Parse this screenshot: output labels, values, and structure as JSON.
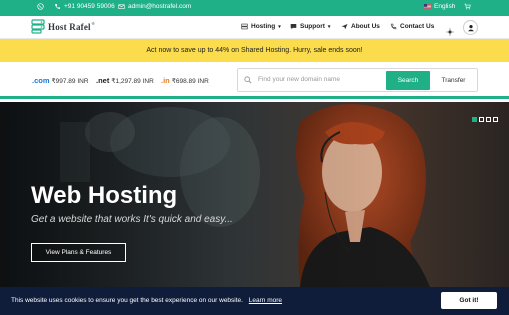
{
  "topbar": {
    "phone": "+91 90459 59006",
    "email": "admin@hostrafel.com",
    "language": "English",
    "colors": {
      "bg": "#1fb087"
    }
  },
  "nav": {
    "logo_text": "Host Rafel",
    "logo_mark": "®",
    "items": [
      {
        "label": "Hosting",
        "icon": "server-icon",
        "dropdown": true
      },
      {
        "label": "Support",
        "icon": "chat-icon",
        "dropdown": true
      },
      {
        "label": "About Us",
        "icon": "paper-plane-icon",
        "dropdown": false
      },
      {
        "label": "Contact Us",
        "icon": "phone-icon",
        "dropdown": false
      }
    ]
  },
  "promo": {
    "text": "Act now to save up to 44% on Shared Hosting. Hurry, sale ends soon!",
    "bg": "#fadc4c"
  },
  "domains": {
    "prices": [
      {
        "tld": ".com",
        "price": "₹997.89 INR"
      },
      {
        "tld": ".net",
        "price": "₹1,297.89 INR"
      },
      {
        "tld": ".in",
        "price": "₹698.89 INR"
      }
    ],
    "search_placeholder": "Find your new domain name",
    "search_label": "Search",
    "transfer_label": "Transfer"
  },
  "hero": {
    "title": "Web Hosting",
    "subtitle": "Get a website that works It's quick and easy...",
    "button": "View Plans & Features",
    "slides": 4,
    "active_slide": 0
  },
  "cookie": {
    "message": "This website uses cookies to ensure you get the best experience on our website.",
    "learn_more": "Learn more",
    "accept": "Got it!"
  }
}
